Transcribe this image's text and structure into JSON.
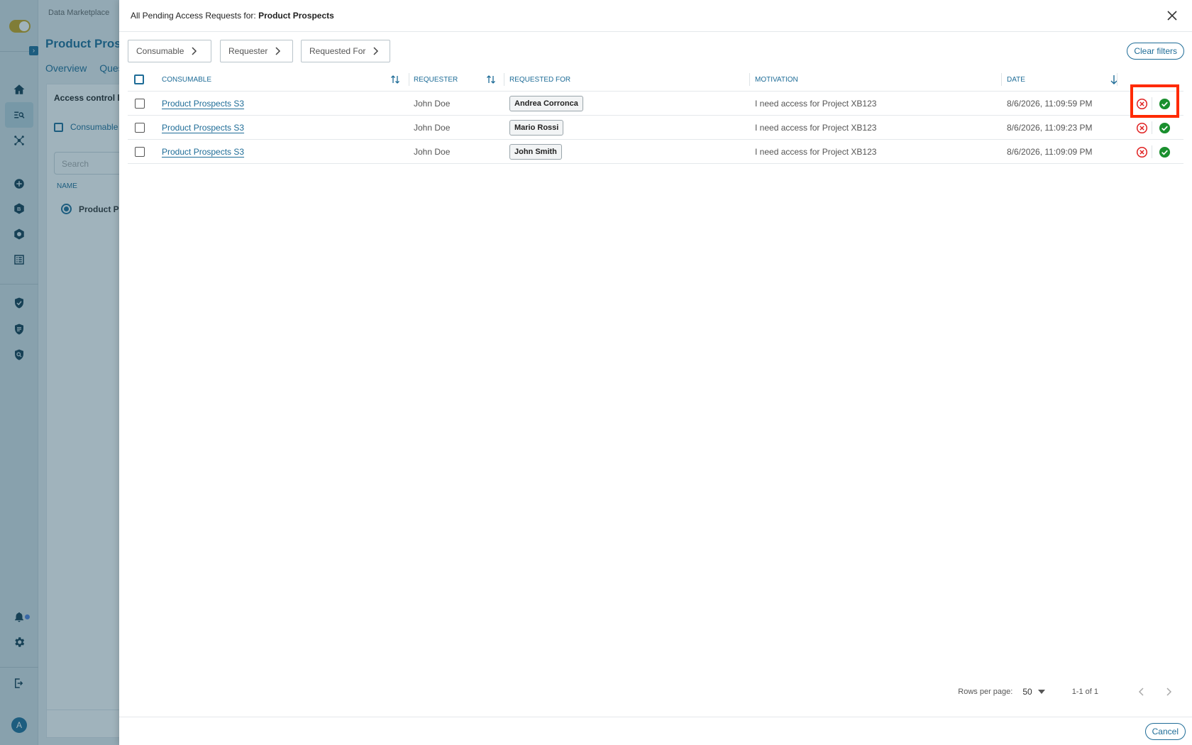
{
  "background": {
    "breadcrumb": "Data Marketplace",
    "page_title": "Product Prosp",
    "tabs": [
      "Overview",
      "Ques"
    ],
    "panel_title": "Access control lis",
    "consumable_label": "Consumable",
    "search_placeholder": "Search",
    "name_header": "NAME",
    "list_item": "Product Pr",
    "avatar_letter": "A"
  },
  "drawer": {
    "title_prefix": "All Pending Access Requests for: ",
    "title_bold": "Product Prospects",
    "filters": [
      "Consumable",
      "Requester",
      "Requested For"
    ],
    "clear_filters": "Clear filters",
    "columns": {
      "consumable": "CONSUMABLE",
      "requester": "REQUESTER",
      "requested_for": "REQUESTED FOR",
      "motivation": "MOTIVATION",
      "date": "DATE"
    },
    "rows": [
      {
        "consumable": "Product Prospects S3",
        "requester": "John Doe",
        "requested_for": "Andrea Corronca",
        "motivation": "I need access for Project XB123",
        "date": "8/6/2026, 11:09:59 PM"
      },
      {
        "consumable": "Product Prospects S3",
        "requester": "John Doe",
        "requested_for": "Mario Rossi",
        "motivation": "I need access for Project XB123",
        "date": "8/6/2026, 11:09:23 PM"
      },
      {
        "consumable": "Product Prospects S3",
        "requester": "John Doe",
        "requested_for": "John Smith",
        "motivation": "I need access for Project XB123",
        "date": "8/6/2026, 11:09:09 PM"
      }
    ],
    "pagination": {
      "rows_per_page_label": "Rows per page:",
      "rows_per_page": "50",
      "range": "1-1 of 1"
    },
    "cancel": "Cancel"
  },
  "icons": {
    "reject": "x-circle-icon",
    "approve": "check-circle-icon",
    "close": "close-icon",
    "sort": "sort-icon"
  },
  "colors": {
    "accent": "#1e6c97",
    "reject": "#e02424",
    "approve": "#1a8f2e",
    "highlight": "#ff2a00"
  }
}
